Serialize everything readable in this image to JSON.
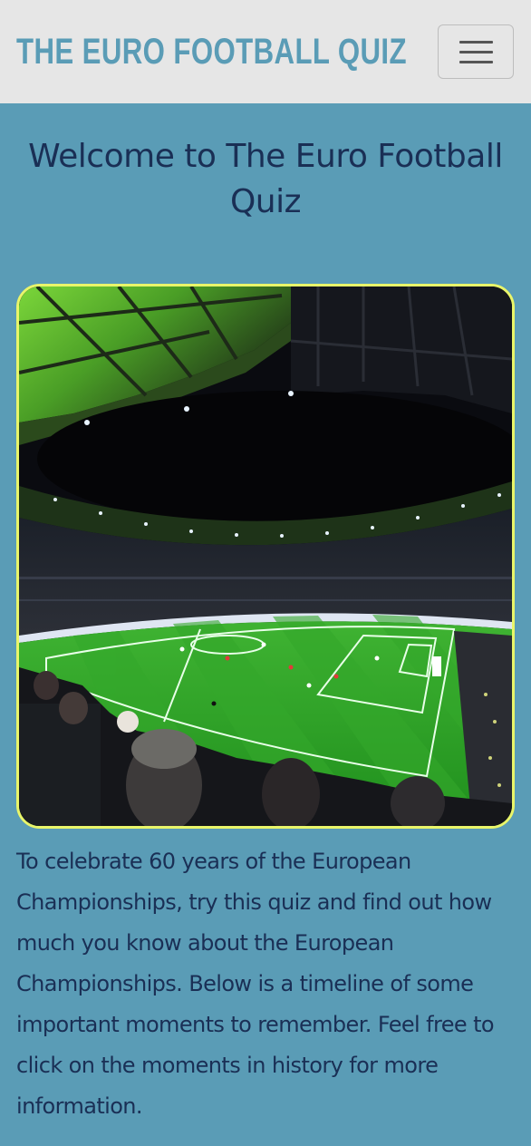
{
  "navbar": {
    "brand": "THE EURO FOOTBALL QUIZ",
    "toggle_icon": "hamburger-menu-icon"
  },
  "main": {
    "heading": "Welcome to The Euro Football Quiz",
    "hero_image": "football-stadium-photo",
    "intro": "To celebrate 60 years of the European Championships, try this quiz and find out how much you know about the European Championships. Below is a timeline of some important moments to remember. Feel free to click on the moments in history for more information."
  },
  "colors": {
    "page_background": "#5a9cb6",
    "navbar_background": "#e6e6e6",
    "brand_text": "#5a9cb6",
    "body_text": "#1a2f55",
    "image_border": "#e9f56a"
  }
}
